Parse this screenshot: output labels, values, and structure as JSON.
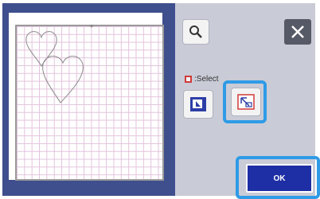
{
  "colors": {
    "panel_left": "#3f4f8e",
    "panel_right": "#c9ccd6",
    "grid_line": "#e3c3dd",
    "highlight": "#2f9be6",
    "ok_button": "#1e2ea5",
    "select_marker": "#d23b3b"
  },
  "toolbar": {
    "zoom_icon": "magnifier-icon",
    "close_icon": "close-icon"
  },
  "select": {
    "label": ":Select",
    "mode_all_icon": "select-all-icon",
    "mode_area_icon": "select-area-icon"
  },
  "footer": {
    "ok_label": "OK"
  }
}
